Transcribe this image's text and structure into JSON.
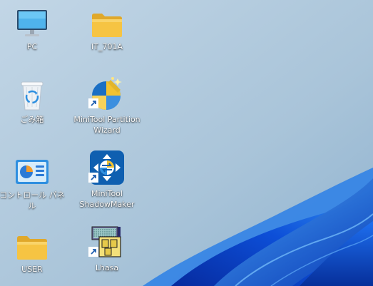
{
  "desktop": {
    "icons": [
      {
        "label": "PC",
        "icon": "monitor-icon"
      },
      {
        "label": "IT_701A",
        "icon": "folder-icon"
      },
      {
        "label": "ごみ箱",
        "icon": "recycle-bin-icon"
      },
      {
        "label": "MiniTool Partition\nWizard",
        "icon": "minitool-partition-wizard-icon",
        "shortcut": true
      },
      {
        "label": "コントロール パネル",
        "icon": "control-panel-icon"
      },
      {
        "label": "MiniTool\nShadowMaker",
        "icon": "minitool-shadowmaker-icon",
        "shortcut": true
      },
      {
        "label": "USER",
        "icon": "folder-icon"
      },
      {
        "label": "Lhasa",
        "icon": "lhasa-icon",
        "shortcut": true
      }
    ]
  },
  "colors": {
    "wallpaper_sky": "#a8c4d8",
    "bloom_deep": "#0a3fc4",
    "bloom_light": "#2a8bf0",
    "folder_yellow": "#f6c443",
    "label_text": "#ffffff"
  }
}
